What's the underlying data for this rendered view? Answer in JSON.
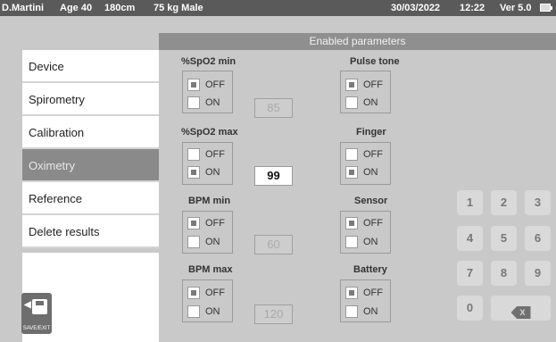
{
  "status": {
    "user": "D.Martini",
    "age": "Age 40",
    "height": "180cm",
    "weight_sex": "75 kg Male",
    "date": "30/03/2022",
    "time": "12:22",
    "version": "Ver 5.0"
  },
  "header": {
    "title": "Enabled parameters"
  },
  "sidebar": {
    "items": [
      {
        "label": "Device"
      },
      {
        "label": "Spirometry"
      },
      {
        "label": "Calibration"
      },
      {
        "label": "Oximetry"
      },
      {
        "label": "Reference"
      },
      {
        "label": "Delete results"
      }
    ],
    "active": "Oximetry",
    "save_exit_label": "SAVE/EXIT"
  },
  "params": {
    "spo2_min": {
      "title": "%SpO2 min",
      "off": "OFF",
      "on": "ON",
      "selected": "OFF",
      "value": "85"
    },
    "spo2_max": {
      "title": "%SpO2 max",
      "off": "OFF",
      "on": "ON",
      "selected": "ON",
      "value": "99"
    },
    "bpm_min": {
      "title": "BPM min",
      "off": "OFF",
      "on": "ON",
      "selected": "OFF",
      "value": "60"
    },
    "bpm_max": {
      "title": "BPM max",
      "off": "OFF",
      "on": "ON",
      "selected": "OFF",
      "value": "120"
    },
    "pulse_tone": {
      "title": "Pulse tone",
      "off": "OFF",
      "on": "ON",
      "selected": "OFF"
    },
    "finger": {
      "title": "Finger",
      "off": "OFF",
      "on": "ON",
      "selected": "ON"
    },
    "sensor": {
      "title": "Sensor",
      "off": "OFF",
      "on": "ON",
      "selected": "OFF"
    },
    "battery": {
      "title": "Battery",
      "off": "OFF",
      "on": "ON",
      "selected": "OFF"
    }
  },
  "keypad": {
    "keys": [
      "1",
      "2",
      "3",
      "4",
      "5",
      "6",
      "7",
      "8",
      "9",
      "0"
    ],
    "backspace": "X"
  }
}
